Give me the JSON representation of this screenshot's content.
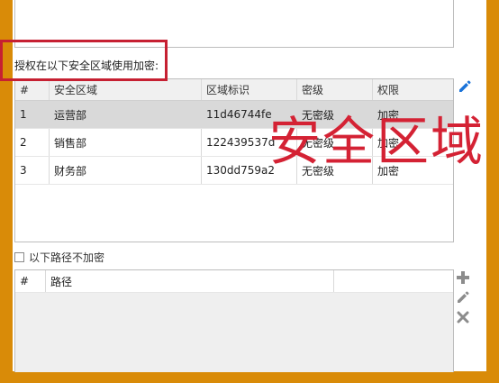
{
  "colors": {
    "frame": "#d98b08",
    "highlight_box": "#c62032",
    "overlay_text": "#d42234",
    "edit_icon": "#1a73d9",
    "gray_icon": "#8c8c8c",
    "selected_row": "#d9d9d9"
  },
  "auth_label": "授权在以下安全区域使用加密:",
  "zones_table": {
    "columns": [
      "#",
      "安全区域",
      "区域标识",
      "密级",
      "权限"
    ],
    "rows": [
      {
        "num": "1",
        "zone": "运营部",
        "id": "11d46744fe",
        "level": "无密级",
        "perm": "加密",
        "selected": true
      },
      {
        "num": "2",
        "zone": "销售部",
        "id": "122439537d",
        "level": "无密级",
        "perm": "加密",
        "selected": false
      },
      {
        "num": "3",
        "zone": "财务部",
        "id": "130dd759a2",
        "level": "无密级",
        "perm": "加密",
        "selected": false
      }
    ]
  },
  "overlay_caption": "安全区域",
  "exclude_paths": {
    "checkbox_label": "以下路径不加密",
    "checked": false,
    "columns": [
      "#",
      "路径",
      ""
    ]
  },
  "icons": {
    "edit_zone": "pencil-icon",
    "add_path": "plus-icon",
    "edit_path": "pencil-icon",
    "delete_path": "close-icon"
  }
}
